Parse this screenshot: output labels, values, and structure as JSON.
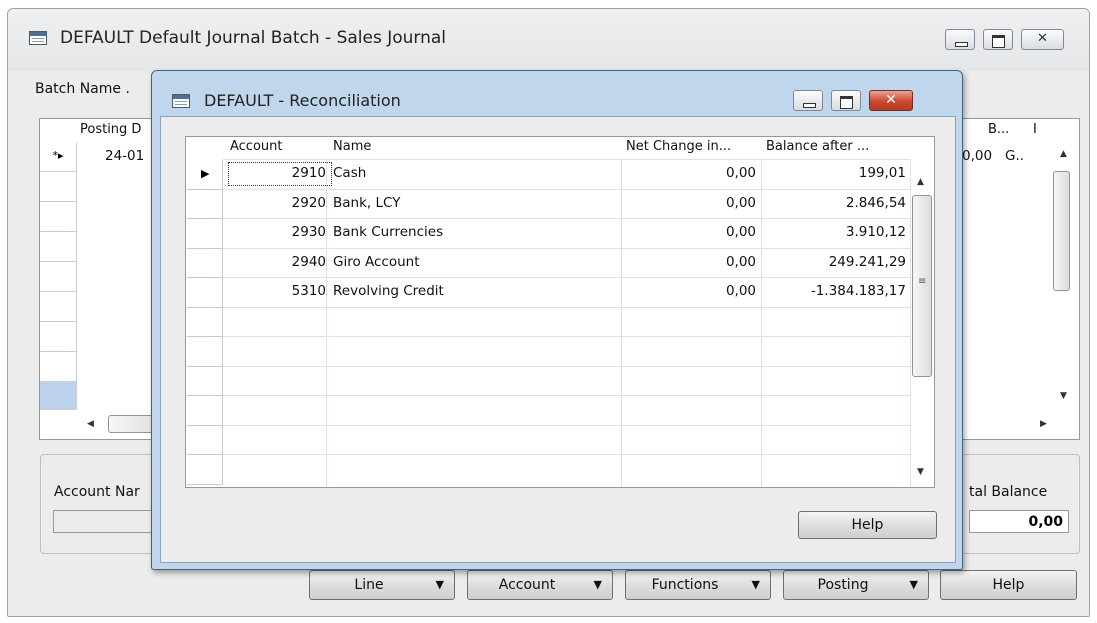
{
  "main_window": {
    "title": "DEFAULT Default Journal Batch - Sales Journal",
    "batch_name_label": "Batch Name .",
    "columns": {
      "posting_date": "Posting D",
      "col_b": "B...",
      "col_i": "I"
    },
    "first_row": {
      "marker": "*▸",
      "posting_date": "24-01",
      "amount": "0,00",
      "col_g": "G.."
    },
    "info": {
      "account_name_label": "Account Nar",
      "total_balance_label": "tal Balance",
      "total_balance_value": "0,00"
    },
    "buttons": {
      "line": "Line",
      "account": "Account",
      "functions": "Functions",
      "posting": "Posting",
      "help": "Help"
    }
  },
  "dialog": {
    "title": "DEFAULT - Reconciliation",
    "columns": {
      "account": "Account",
      "name": "Name",
      "net_change": "Net Change in...",
      "balance_after": "Balance after ..."
    },
    "rows": [
      {
        "account": "2910",
        "name": "Cash",
        "net_change": "0,00",
        "balance_after": "199,01"
      },
      {
        "account": "2920",
        "name": "Bank, LCY",
        "net_change": "0,00",
        "balance_after": "2.846,54"
      },
      {
        "account": "2930",
        "name": "Bank Currencies",
        "net_change": "0,00",
        "balance_after": "3.910,12"
      },
      {
        "account": "2940",
        "name": "Giro Account",
        "net_change": "0,00",
        "balance_after": "249.241,29"
      },
      {
        "account": "5310",
        "name": "Revolving Credit",
        "net_change": "0,00",
        "balance_after": "-1.384.183,17"
      }
    ],
    "help_button": "Help"
  },
  "colors": {
    "dialog_frame": "#bfd6ec",
    "close_red": "#c9482f",
    "selector_highlight": "#bcd2ec"
  }
}
